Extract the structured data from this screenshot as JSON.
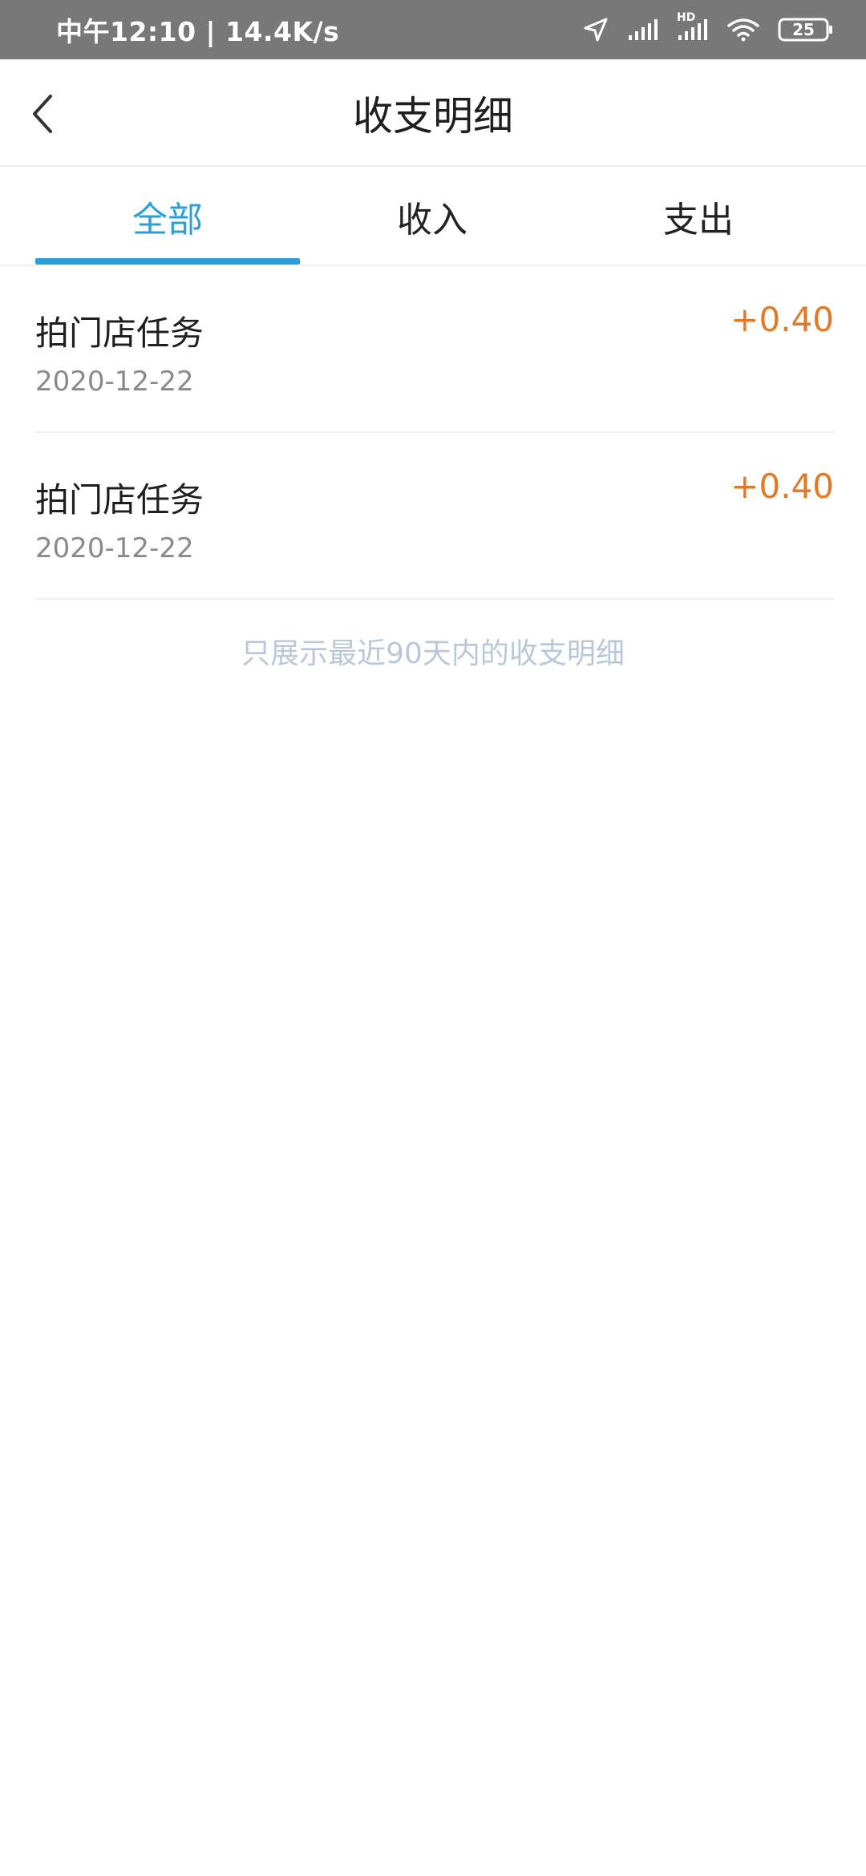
{
  "status_bar": {
    "time_speed": "中午12:10 | 14.4K/s",
    "hd_label": "HD",
    "battery": "25"
  },
  "header": {
    "title": "收支明细"
  },
  "tabs": [
    {
      "label": "全部",
      "active": true
    },
    {
      "label": "收入",
      "active": false
    },
    {
      "label": "支出",
      "active": false
    }
  ],
  "transactions": [
    {
      "title": "拍门店任务",
      "date": "2020-12-22",
      "amount": "+0.40"
    },
    {
      "title": "拍门店任务",
      "date": "2020-12-22",
      "amount": "+0.40"
    }
  ],
  "footer_note": "只展示最近90天内的收支明细",
  "colors": {
    "accent": "#2aa0da",
    "amount": "#e07a28",
    "status_bar_bg": "#787878"
  }
}
